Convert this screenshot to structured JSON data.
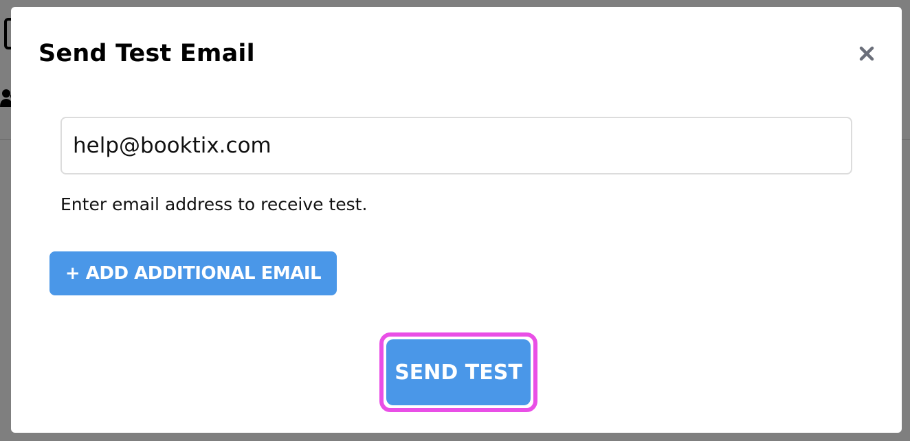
{
  "modal": {
    "title": "Send Test Email",
    "close_icon": "close-icon",
    "email_input": {
      "value": "help@booktix.com",
      "placeholder": ""
    },
    "helper_text": "Enter email address to receive test.",
    "add_email_label": "+ ADD ADDITIONAL EMAIL",
    "send_test_label": "SEND TEST"
  },
  "background": {
    "icons": [
      "calendar-icon",
      "users-icon"
    ]
  },
  "colors": {
    "primary_button": "#4a97e8",
    "highlight": "#e94fe6",
    "overlay": "#7d7d7d",
    "close_icon": "#6b6f7a"
  }
}
